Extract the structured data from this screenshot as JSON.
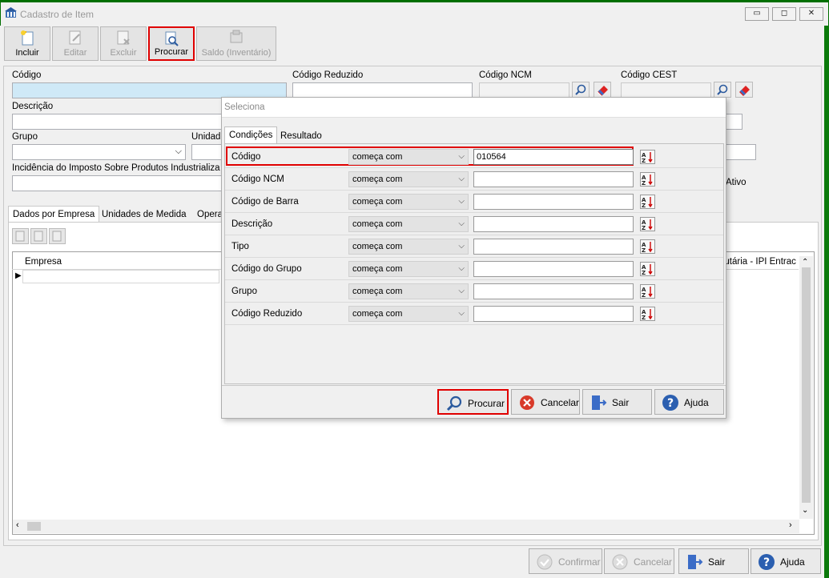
{
  "window": {
    "title": "Cadastro de Item",
    "min": "▭",
    "max": "◻",
    "close": "✕"
  },
  "toolbar": [
    {
      "label": "Incluir",
      "enabled": true
    },
    {
      "label": "Editar",
      "enabled": false
    },
    {
      "label": "Excluir",
      "enabled": false
    },
    {
      "label": "Procurar",
      "enabled": true
    },
    {
      "label": "Saldo (Inventário)",
      "enabled": false
    }
  ],
  "form": {
    "codigo": "Código",
    "codigo_reduzido": "Código Reduzido",
    "codigo_ncm": "Código NCM",
    "codigo_cest": "Código CEST",
    "descricao": "Descrição",
    "grupo": "Grupo",
    "unidade": "Unidad",
    "ipi": "Incidência do Imposto Sobre Produtos Industrializa",
    "ativo": "Ativo"
  },
  "tabs": [
    "Dados por Empresa",
    "Unidades de Medida",
    "Opera"
  ],
  "grid": {
    "col_empresa": "Empresa",
    "col_right": "butária - IPI Entrac"
  },
  "dialog": {
    "title": "Seleciona",
    "tabs": [
      "Condições",
      "Resultado"
    ],
    "rows": [
      {
        "field": "Código",
        "operator": "começa com",
        "value": "010564"
      },
      {
        "field": "Código NCM",
        "operator": "começa com",
        "value": ""
      },
      {
        "field": "Código de Barra",
        "operator": "começa com",
        "value": ""
      },
      {
        "field": "Descrição",
        "operator": "começa com",
        "value": ""
      },
      {
        "field": "Tipo",
        "operator": "começa com",
        "value": ""
      },
      {
        "field": "Código do Grupo",
        "operator": "começa com",
        "value": ""
      },
      {
        "field": "Grupo",
        "operator": "começa com",
        "value": ""
      },
      {
        "field": "Código Reduzido",
        "operator": "começa com",
        "value": ""
      }
    ],
    "buttons": {
      "procurar": "Procurar",
      "cancelar": "Cancelar",
      "sair": "Sair",
      "ajuda": "Ajuda"
    }
  },
  "footer": {
    "confirmar": "Confirmar",
    "cancelar": "Cancelar",
    "sair": "Sair",
    "ajuda": "Ajuda"
  },
  "colors": {
    "highlight": "#e00000",
    "window_border": "#006f00",
    "field_focus": "#cfe9f7"
  }
}
